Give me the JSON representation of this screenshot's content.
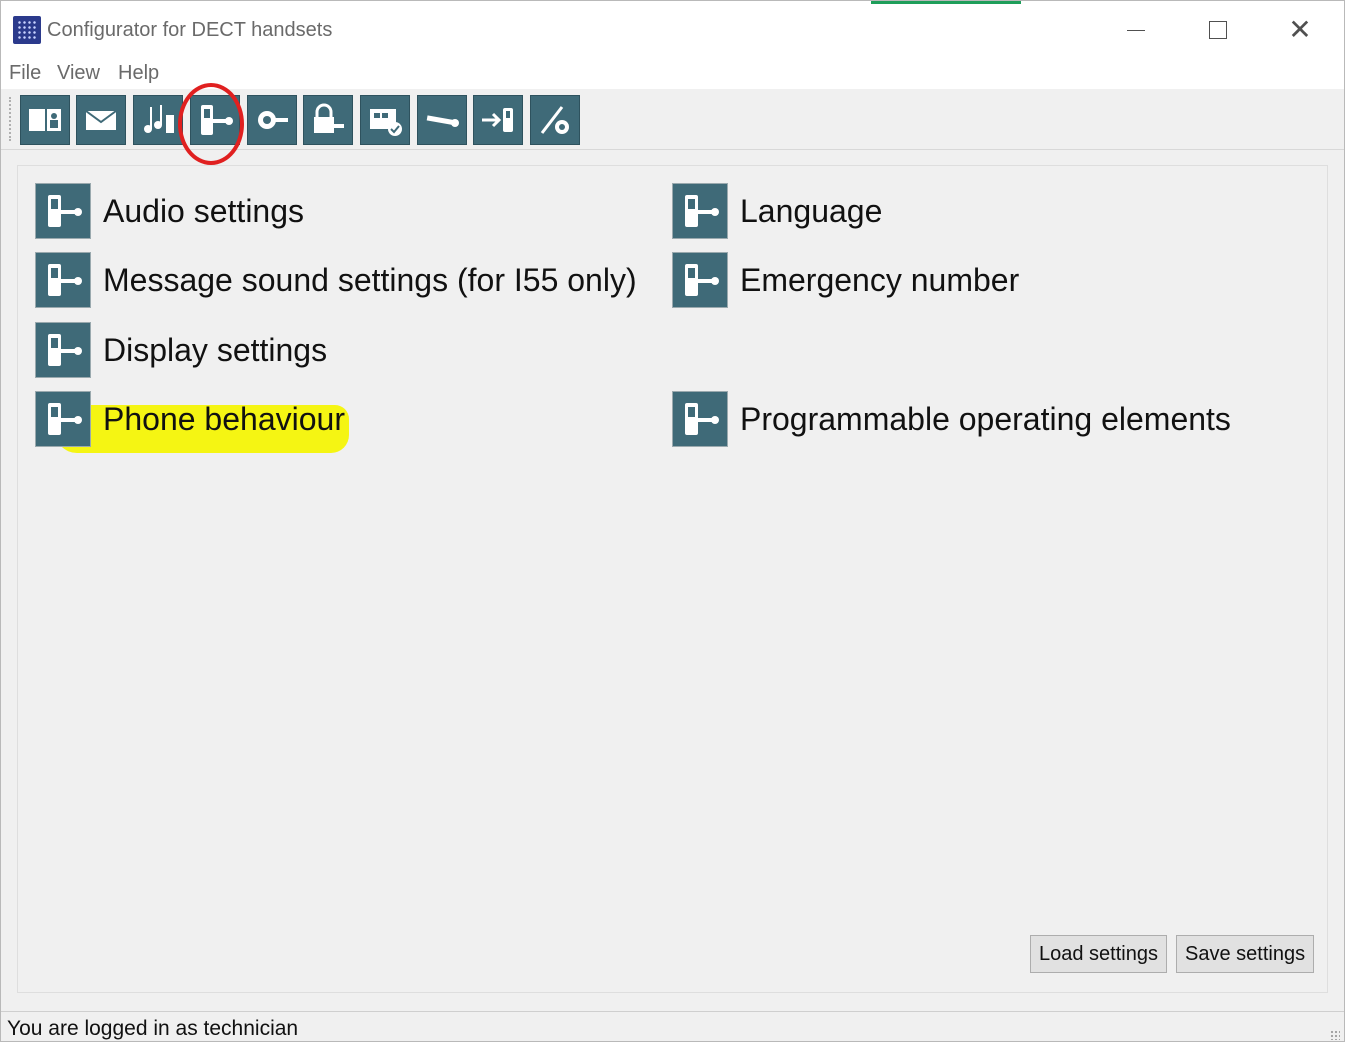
{
  "window": {
    "title": "Configurator for DECT handsets"
  },
  "menu": {
    "items": [
      "File",
      "View",
      "Help"
    ]
  },
  "toolbar": {
    "buttons": [
      {
        "icon": "address-book-icon"
      },
      {
        "icon": "envelope-icon"
      },
      {
        "icon": "music-notes-icon"
      },
      {
        "icon": "handset-wrench-icon",
        "selected": true
      },
      {
        "icon": "gear-wrench-icon"
      },
      {
        "icon": "lock-wrench-icon"
      },
      {
        "icon": "calendar-check-icon"
      },
      {
        "icon": "wrench-icon"
      },
      {
        "icon": "arrow-to-handset-icon"
      },
      {
        "icon": "pen-gear-icon"
      }
    ]
  },
  "settings": {
    "left": [
      {
        "label": "Audio settings"
      },
      {
        "label": "Message sound settings (for I55 only)"
      },
      {
        "label": "Display settings"
      },
      {
        "label": "Phone behaviour"
      }
    ],
    "right": [
      {
        "label": "Language"
      },
      {
        "label": "Emergency number"
      },
      {
        "label": "Programmable operating elements"
      }
    ]
  },
  "buttons": {
    "load": "Load settings",
    "save": "Save settings"
  },
  "status": {
    "text": "You are logged in as technician"
  },
  "colors": {
    "icon_bg": "#3f6a78",
    "highlight": "#f5f500",
    "annotation_circle": "#e02020",
    "accent": "#1e9e5a"
  }
}
